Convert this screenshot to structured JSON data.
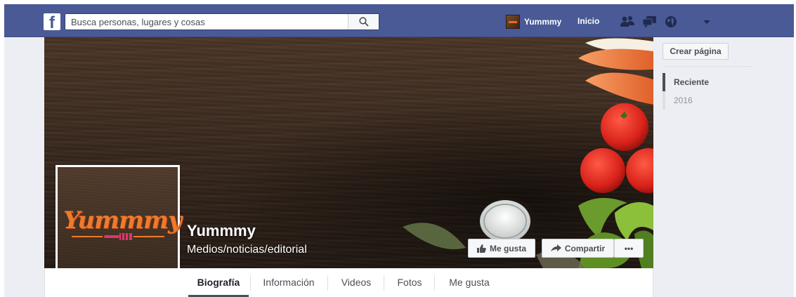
{
  "topbar": {
    "logo": "f",
    "search_placeholder": "Busca personas, lugares y cosas",
    "user_name": "Yummmy",
    "home_label": "Inicio",
    "icons": [
      "friends-icon",
      "messages-icon",
      "globe-icon",
      "dropdown-icon"
    ],
    "bar_color": "#4a5a96"
  },
  "cover": {
    "logo_text": "Yummmy",
    "page_name": "Yummmy",
    "category": "Medios/noticias/editorial",
    "like_label": "Me gusta",
    "share_label": "Compartir",
    "more_label": "•••",
    "brand_color": "#f07a2a"
  },
  "tabs": [
    {
      "label": "Biografía",
      "active": true
    },
    {
      "label": "Información",
      "active": false
    },
    {
      "label": "Videos",
      "active": false
    },
    {
      "label": "Fotos",
      "active": false
    },
    {
      "label": "Me gusta",
      "active": false
    }
  ],
  "sidebar": {
    "create_page_label": "Crear página",
    "timeline": [
      {
        "label": "Reciente",
        "active": true
      },
      {
        "label": "2016",
        "active": false
      }
    ]
  }
}
